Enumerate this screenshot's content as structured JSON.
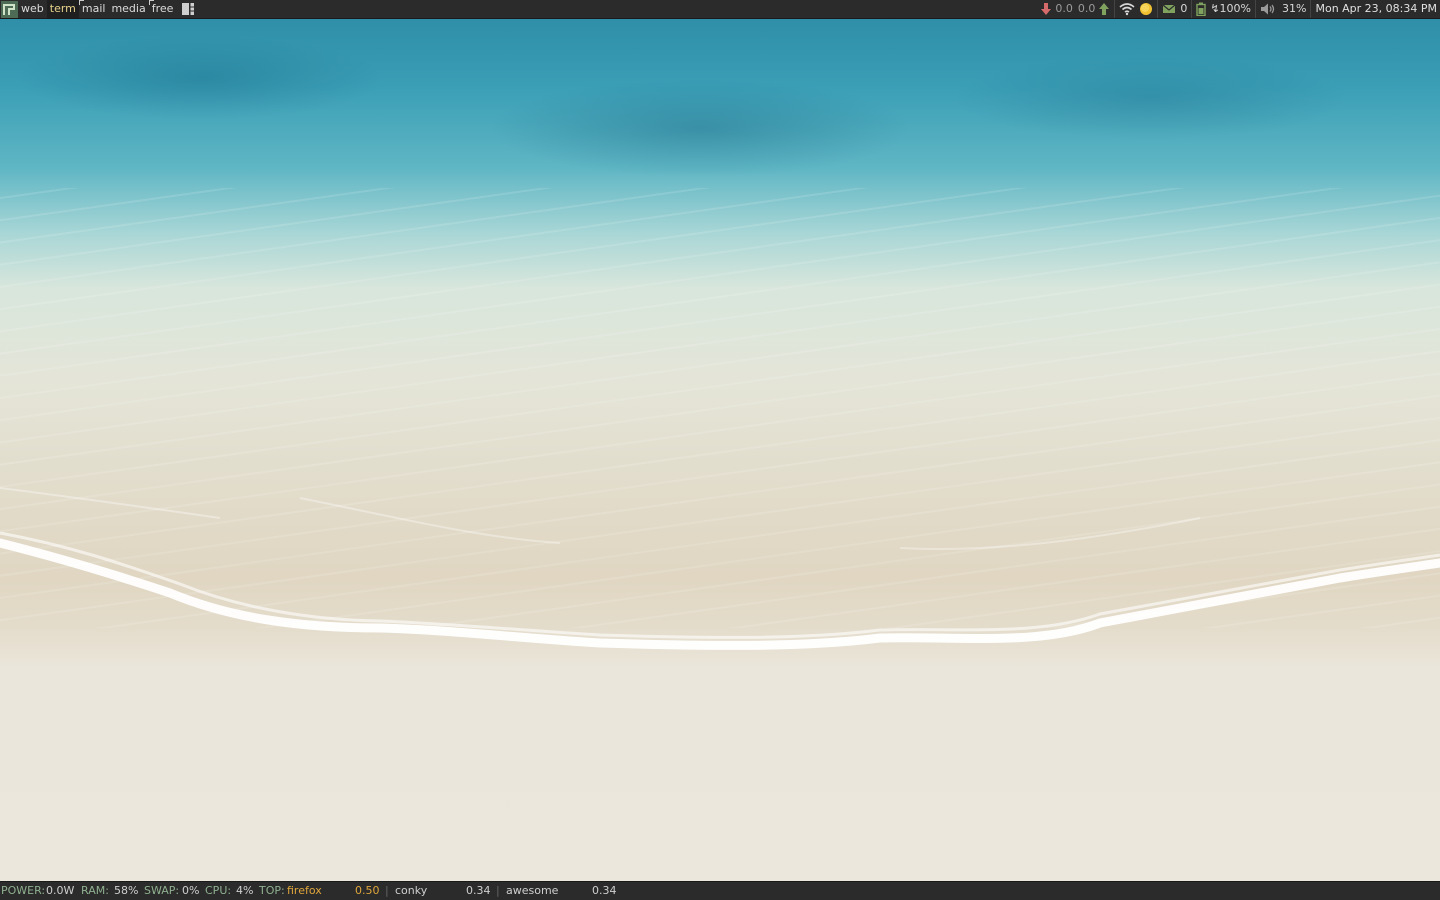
{
  "topbar": {
    "tags": [
      {
        "label": "web",
        "active": false
      },
      {
        "label": "term",
        "active": true
      },
      {
        "label": "mail",
        "active": false
      },
      {
        "label": "media",
        "active": false
      },
      {
        "label": "free",
        "active": false
      }
    ],
    "net_down": "0.0",
    "net_up": "0.0",
    "mail_count": "0",
    "battery": "↯100%",
    "volume": "31%",
    "clock": "Mon Apr 23, 08:34 PM"
  },
  "bottombar": {
    "power_label": "POWER:",
    "power_value": "0.0W",
    "ram_label": "RAM:",
    "ram_value": "58%",
    "swap_label": "SWAP:",
    "swap_value": "0%",
    "cpu_label": "CPU:",
    "cpu_value": "4%",
    "top_label": "TOP:",
    "processes": [
      {
        "name": "firefox",
        "value": "0.50"
      },
      {
        "name": "conky",
        "value": "0.34"
      },
      {
        "name": "awesome",
        "value": "0.34"
      }
    ],
    "separator": "|"
  },
  "colors": {
    "bar_bg": "#2b2b2b",
    "active_tag": "#e8d28c",
    "accent_orange": "#e0a63c",
    "label_green": "#8fb08f",
    "launcher_green": "#4d6b55"
  },
  "icons": {
    "launcher": "awesome-launcher-icon",
    "layout": "tile-layout-icon",
    "down": "arrow-down-icon",
    "up": "arrow-up-icon",
    "wifi": "wifi-icon",
    "weather": "sun-icon",
    "mail": "mail-icon",
    "battery": "battery-icon",
    "volume": "speaker-icon"
  }
}
